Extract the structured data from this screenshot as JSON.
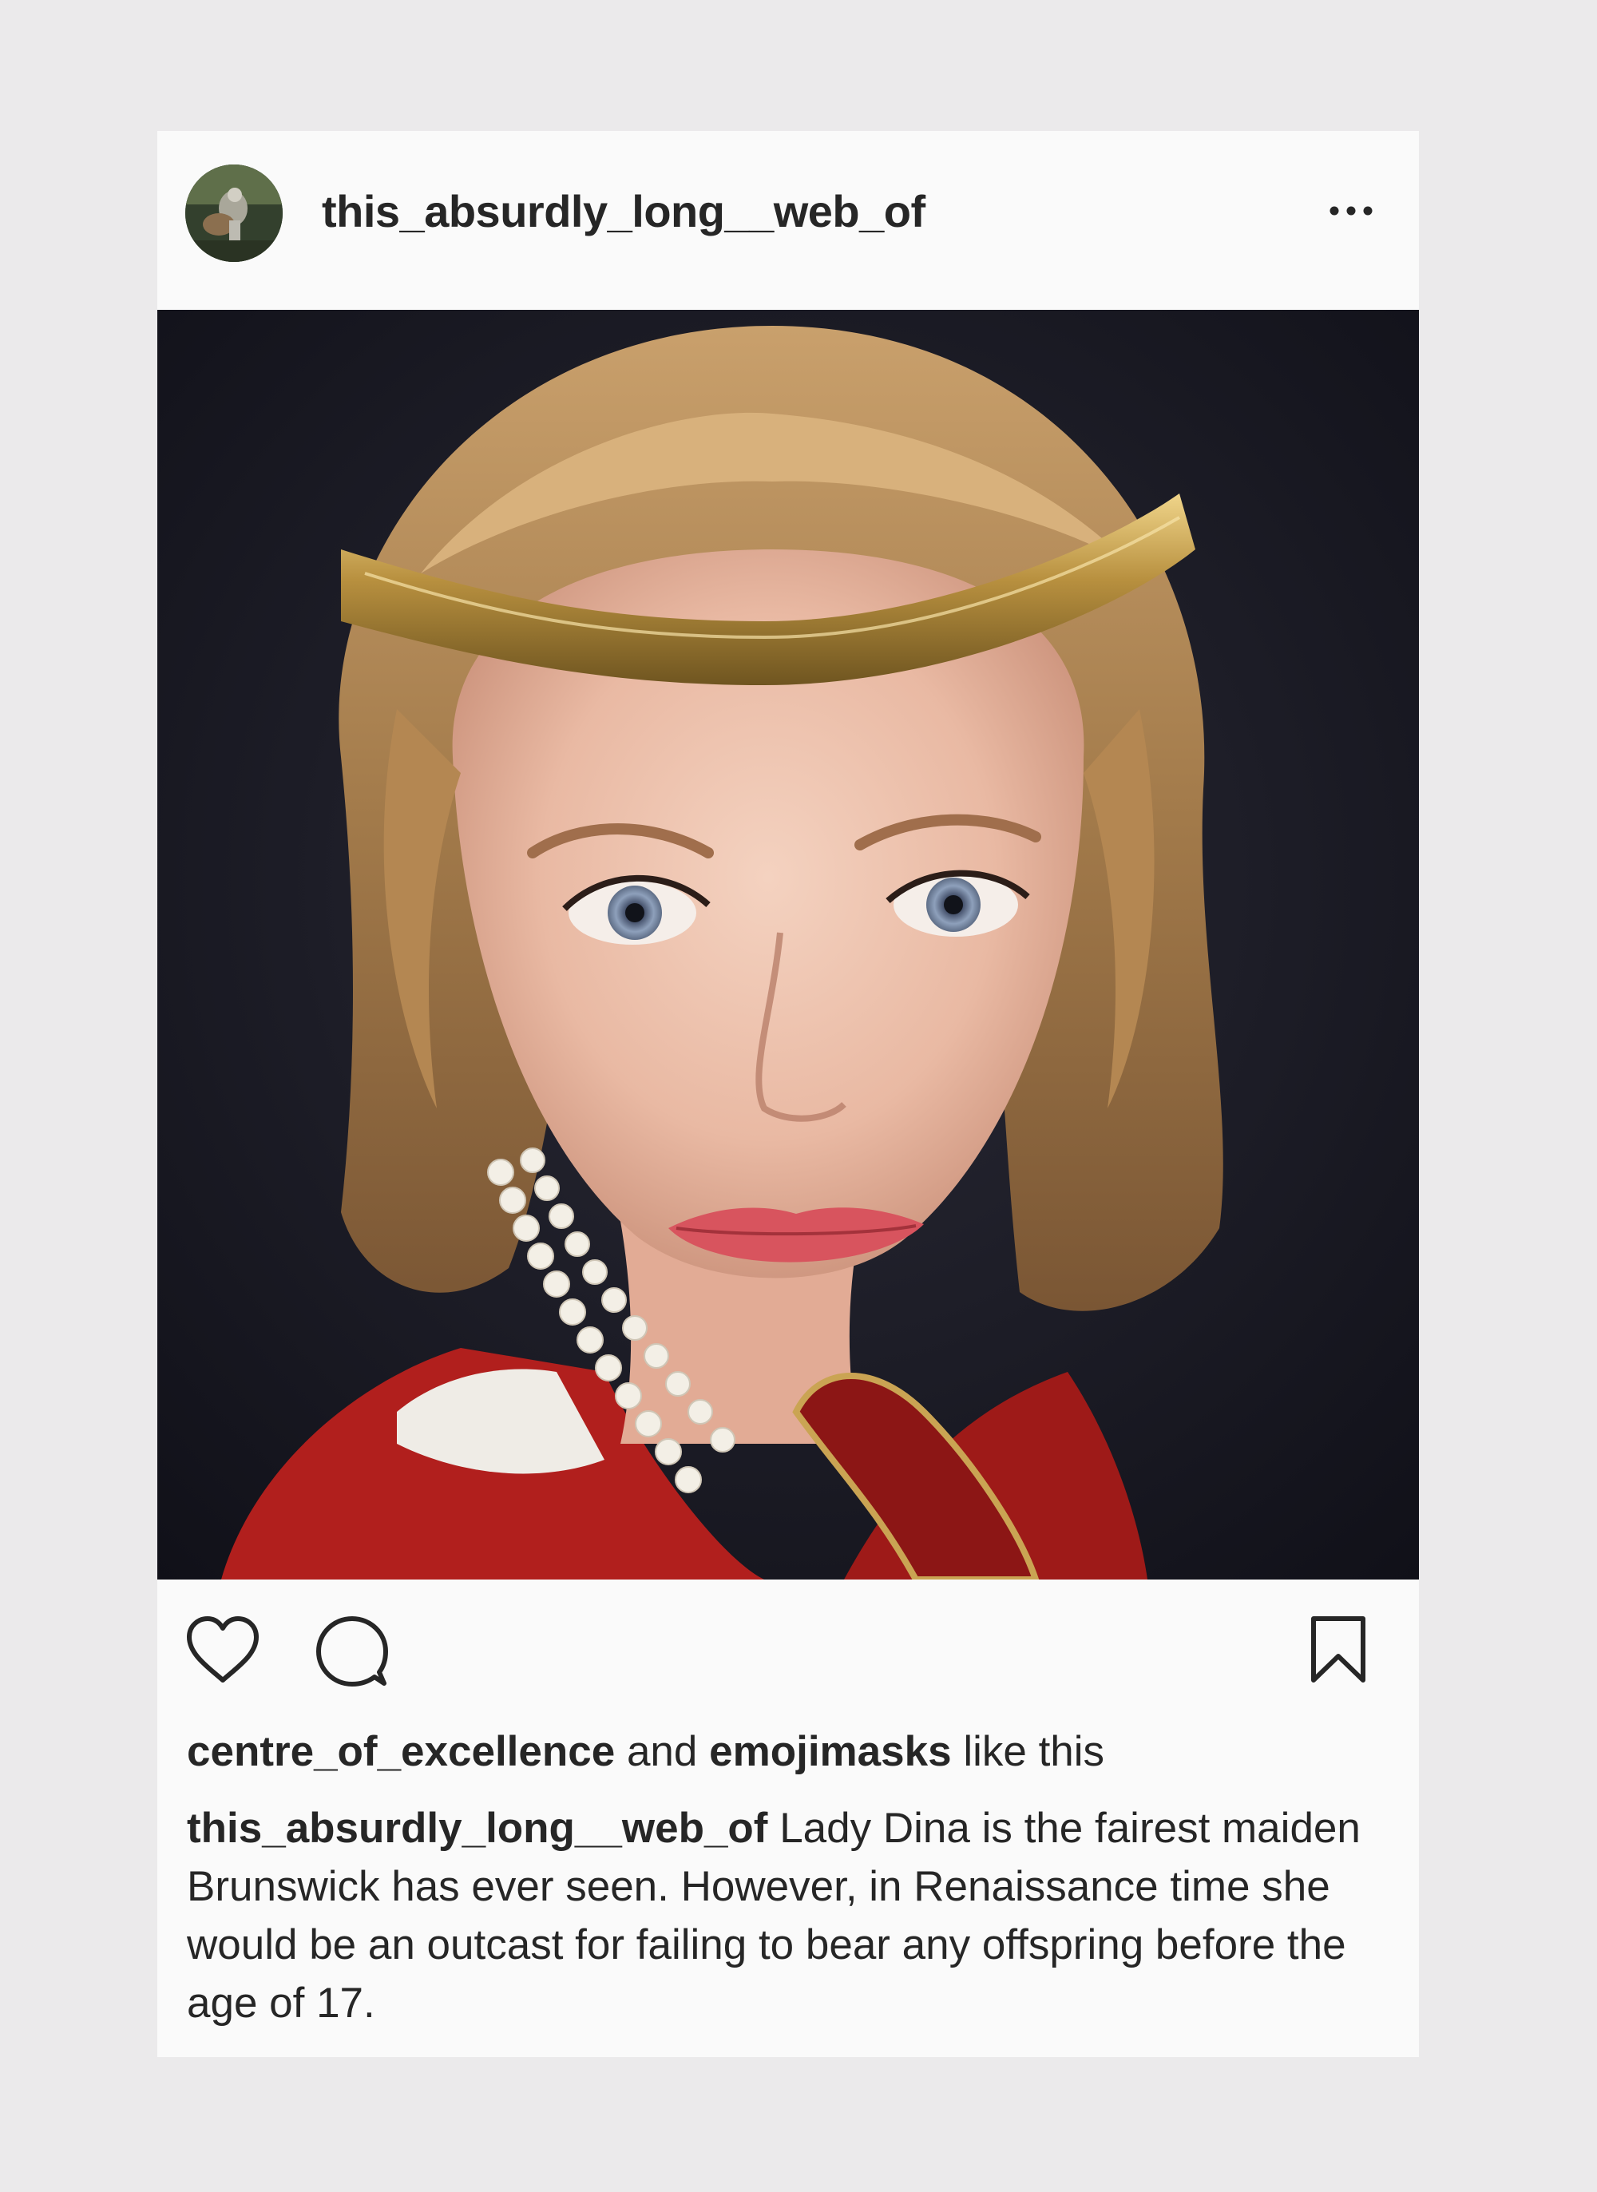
{
  "post": {
    "username": "this_absurdly_long__web_of",
    "more_icon": "more-horizontal-icon",
    "photo_icon": "portrait-photo"
  },
  "actions": {
    "like_icon": "heart-icon",
    "comment_icon": "comment-bubble-icon",
    "save_icon": "bookmark-icon"
  },
  "likes": {
    "user1": "centre_of_excellence",
    "and": "and",
    "user2": "emojimasks",
    "suffix": "like this"
  },
  "caption": {
    "username": "this_absurdly_long__web_of",
    "text": "Lady Dina is the fairest maiden Brunswick has ever seen. However, in Renaissance time she would be an outcast for failing to bear any offspring before the age of 17."
  },
  "colors": {
    "page_background": "#ebeaeb",
    "card_background": "#fafafa",
    "text": "#262626"
  }
}
